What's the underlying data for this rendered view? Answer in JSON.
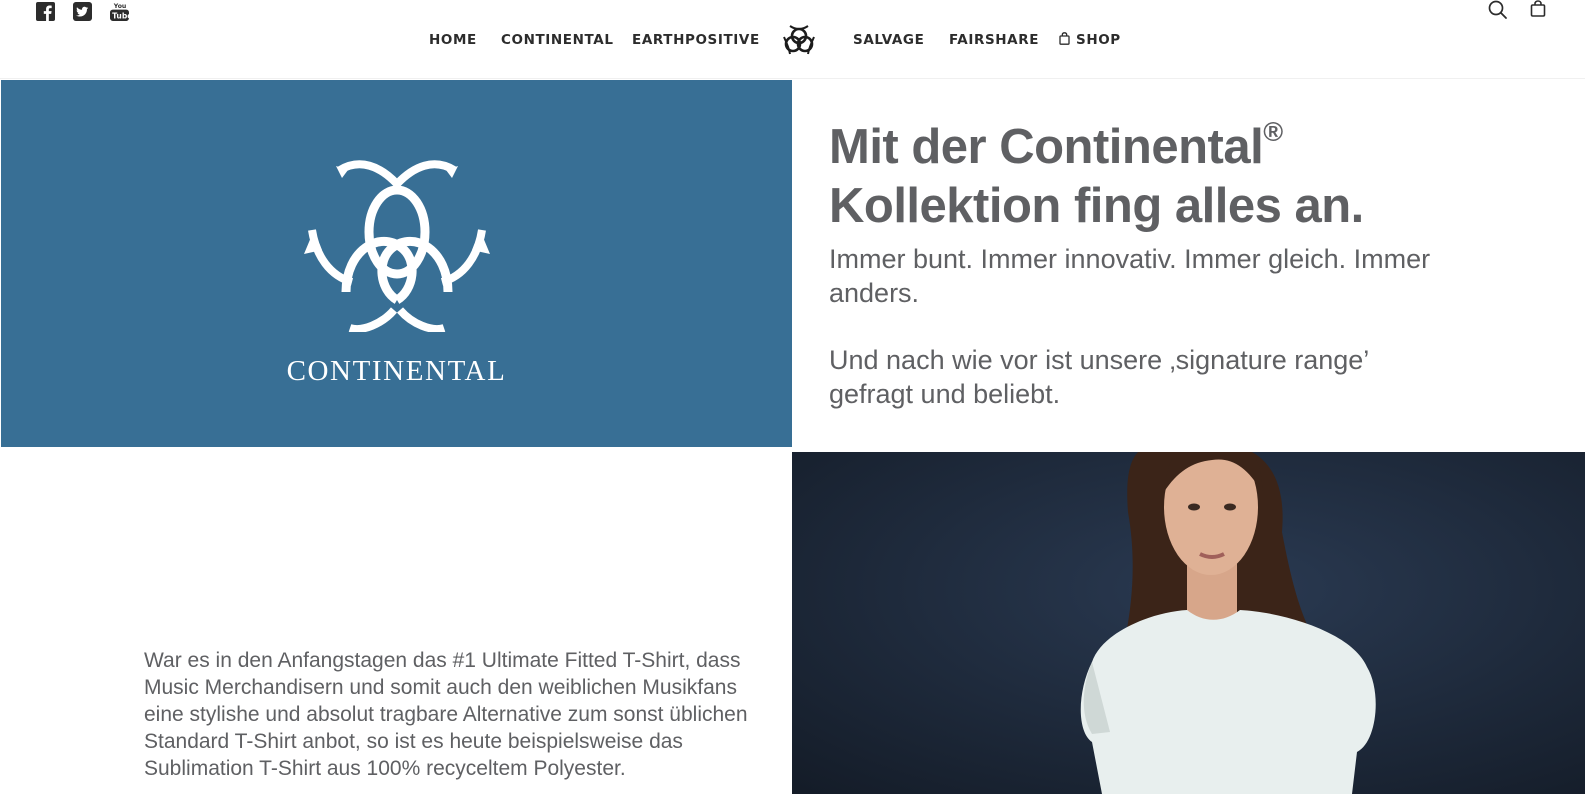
{
  "header": {
    "social": [
      {
        "name": "facebook-icon"
      },
      {
        "name": "twitter-icon"
      },
      {
        "name": "youtube-icon"
      }
    ],
    "nav": {
      "home": "HOME",
      "continental": "CONTINENTAL",
      "earthpositive": "EARTHPOSITIVE",
      "salvage": "SALVAGE",
      "fairshare": "FAIRSHARE",
      "shop": "SHOP"
    },
    "icons": {
      "search": "search-icon",
      "cart": "shopping-bag-icon"
    }
  },
  "hero": {
    "brand": "CONTINENTAL",
    "panel_color": "#386f95",
    "headline_line1": "Mit der Continental",
    "headline_reg": "®",
    "headline_line2": "Kollektion fing alles an.",
    "lead_p1": "Immer bunt. Immer innovativ. Immer gleich. Immer anders.",
    "lead_p2": "Und nach wie vor ist unsere ‚signature range’ gefragt und beliebt."
  },
  "section2": {
    "body": "War es in den Anfangstagen das #1 Ultimate Fitted T-Shirt, dass Music Merchandisern und somit auch den weiblichen Musikfans eine stylishe und absolut tragbare Alternative zum sonst üblichen Standard T-Shirt anbot, so ist es heute beispielsweise das Sublimation T-Shirt aus 100% recyceltem Polyester."
  }
}
